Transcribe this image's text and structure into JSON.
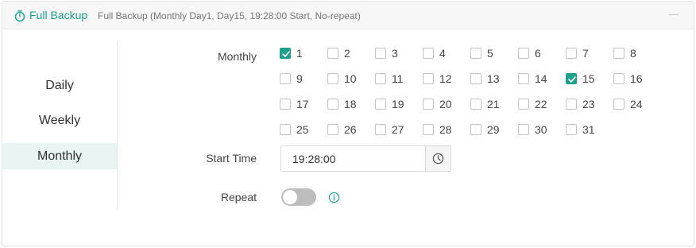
{
  "header": {
    "title": "Full Backup",
    "description": "Full Backup (Monthly Day1, Day15, 19:28:00 Start, No-repeat)",
    "icon": "timer-icon"
  },
  "sidebar": {
    "items": [
      {
        "label": "Daily",
        "active": false
      },
      {
        "label": "Weekly",
        "active": false
      },
      {
        "label": "Monthly",
        "active": true
      }
    ]
  },
  "form": {
    "monthly_label": "Monthly",
    "days": [
      {
        "label": "1",
        "checked": true
      },
      {
        "label": "2",
        "checked": false
      },
      {
        "label": "3",
        "checked": false
      },
      {
        "label": "4",
        "checked": false
      },
      {
        "label": "5",
        "checked": false
      },
      {
        "label": "6",
        "checked": false
      },
      {
        "label": "7",
        "checked": false
      },
      {
        "label": "8",
        "checked": false
      },
      {
        "label": "9",
        "checked": false
      },
      {
        "label": "10",
        "checked": false
      },
      {
        "label": "11",
        "checked": false
      },
      {
        "label": "12",
        "checked": false
      },
      {
        "label": "13",
        "checked": false
      },
      {
        "label": "14",
        "checked": false
      },
      {
        "label": "15",
        "checked": true
      },
      {
        "label": "16",
        "checked": false
      },
      {
        "label": "17",
        "checked": false
      },
      {
        "label": "18",
        "checked": false
      },
      {
        "label": "19",
        "checked": false
      },
      {
        "label": "20",
        "checked": false
      },
      {
        "label": "21",
        "checked": false
      },
      {
        "label": "22",
        "checked": false
      },
      {
        "label": "23",
        "checked": false
      },
      {
        "label": "24",
        "checked": false
      },
      {
        "label": "25",
        "checked": false
      },
      {
        "label": "26",
        "checked": false
      },
      {
        "label": "27",
        "checked": false
      },
      {
        "label": "28",
        "checked": false
      },
      {
        "label": "29",
        "checked": false
      },
      {
        "label": "30",
        "checked": false
      },
      {
        "label": "31",
        "checked": false
      }
    ],
    "start_time_label": "Start Time",
    "start_time_value": "19:28:00",
    "repeat_label": "Repeat",
    "repeat_enabled": false
  },
  "colors": {
    "accent": "#1aa38a",
    "active_bg": "#e8f5f2",
    "toggle_off": "#bdbdbd"
  }
}
